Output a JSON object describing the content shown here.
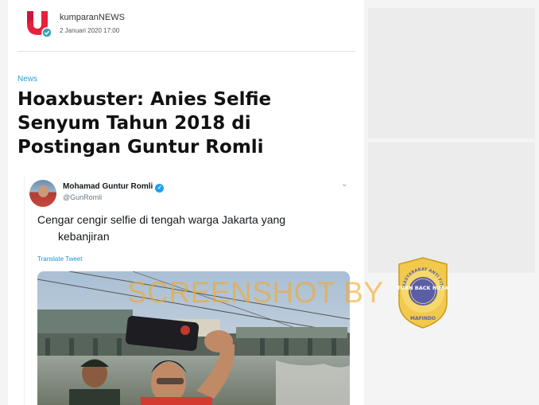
{
  "author": {
    "name": "kumparanNEWS",
    "date": "2 Januari 2020 17:00"
  },
  "article": {
    "category": "News",
    "title": "Hoaxbuster: Anies Selfie Senyum Tahun 2018 di Postingan Guntur Romli"
  },
  "tweet": {
    "name": "Mohamad Guntur Romli",
    "handle": "@GunRomli",
    "text_line1": "Cengar cengir selfie di tengah warga Jakarta yang",
    "text_line2": "kebanjiran",
    "translate": "Translate Tweet"
  },
  "watermark": {
    "text": "SCREENSHOT BY"
  },
  "badge": {
    "center_text": "TURN BACK HOAX",
    "ring_text": "MASYARAKAT ANTI FITNAH INDONESIA",
    "bottom_text": "MAFINDO"
  },
  "icons": {
    "logo": "kumparan-logo",
    "verified": "verified-check-icon",
    "chevron": "chevron-down-icon"
  },
  "colors": {
    "category": "#2a9fd6",
    "verified": "#1da1f2",
    "logo_red": "#e8203a",
    "logo_teal": "#3aa3b8",
    "watermark": "#f4a828",
    "badge_gold": "#f2c94c",
    "badge_blue": "#5b5ea6"
  }
}
